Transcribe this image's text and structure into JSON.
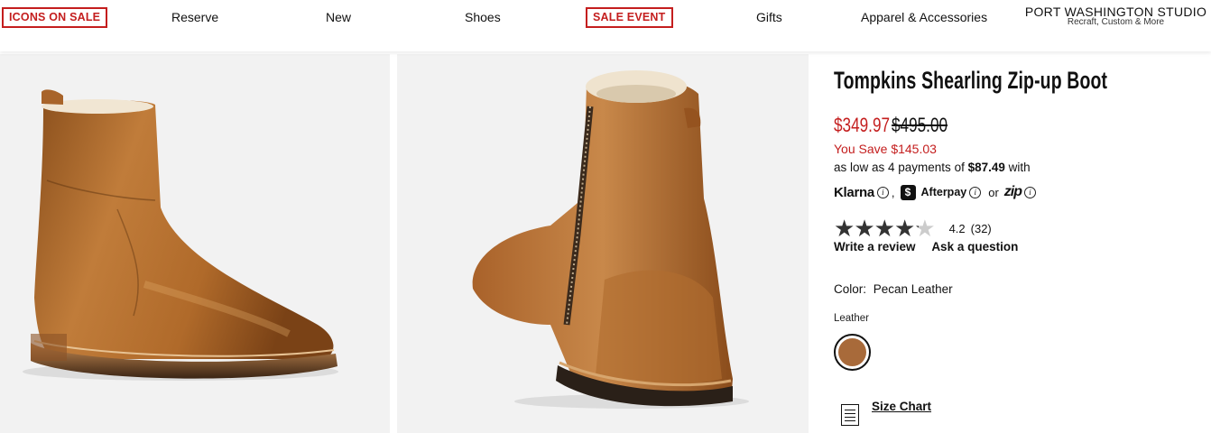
{
  "nav": {
    "icons_on_sale": "ICONS ON SALE",
    "reserve": "Reserve",
    "new": "New",
    "shoes": "Shoes",
    "sale_event": "SALE EVENT",
    "gifts": "Gifts",
    "apparel": "Apparel & Accessories",
    "pws_title": "PORT WASHINGTON STUDIO",
    "pws_sub": "Recraft, Custom & More"
  },
  "product": {
    "title": "Tompkins Shearling Zip-up Boot",
    "price_sale": "$349.97",
    "price_orig": "$495.00",
    "you_save": "You Save $145.03",
    "payments_prefix": "as low as 4 payments of",
    "payments_amount": "$87.49",
    "payments_suffix": "with",
    "klarna": "Klarna",
    "comma": ",",
    "afterpay": "Afterpay",
    "or": "or",
    "zip": "zip",
    "rating": "4.2",
    "review_count": "(32)",
    "rating_value": 4.2,
    "write_review": "Write a review",
    "ask_question": "Ask a question",
    "color_label": "Color:",
    "color_value": "Pecan Leather",
    "material": "Leather",
    "size_chart": "Size Chart"
  },
  "colors": {
    "sale_red": "#c41e1e",
    "swatch": "#a86a3a",
    "leather": "#b4702f",
    "leather_dark": "#7d4718",
    "panel_bg": "#f2f2f2"
  },
  "icons": {
    "info": "info-icon",
    "afterpay": "afterpay-icon",
    "size_chart": "document-icon"
  }
}
